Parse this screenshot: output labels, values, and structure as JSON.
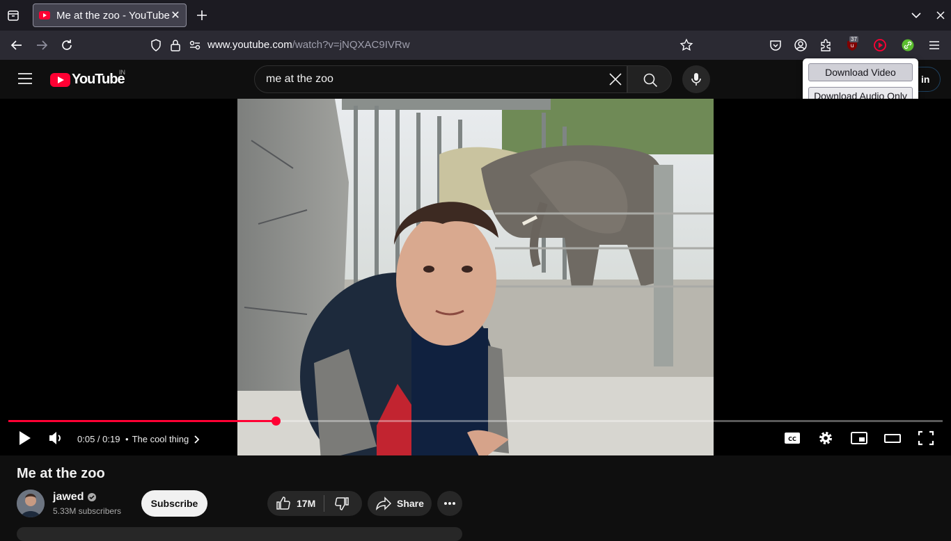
{
  "browser": {
    "tab_title": "Me at the zoo - YouTube",
    "url_host": "www.youtube.com",
    "url_path": "/watch?v=jNQXAC9IVRw",
    "extension_badge": "37"
  },
  "masthead": {
    "logo_text": "YouTube",
    "country_code": "IN",
    "search_value": "me at the zoo",
    "sign_in_partial": "in"
  },
  "popup": {
    "download_video": "Download Video",
    "download_audio": "Download Audio Only"
  },
  "player": {
    "current_time": "0:05",
    "duration": "0:19",
    "time_display": "0:05 / 0:19",
    "chapter_separator": "•",
    "chapter": "The cool thing",
    "progress_fraction": 0.286
  },
  "video": {
    "title": "Me at the zoo",
    "channel": "jawed",
    "subscribers": "5.33M subscribers",
    "subscribe_label": "Subscribe",
    "likes": "17M",
    "share_label": "Share"
  },
  "colors": {
    "accent": "#ff0033",
    "page_bg": "#0f0f0f"
  }
}
